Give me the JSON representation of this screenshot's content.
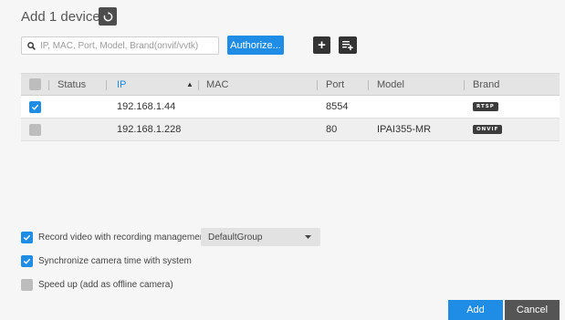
{
  "header": {
    "title": "Add 1 devices",
    "refresh_icon": "refresh-icon"
  },
  "toolbar": {
    "search_placeholder": "IP, MAC, Port, Model, Brand(onvif/vvtk)",
    "search_value": "",
    "authorize_label": "Authorize...",
    "plus_label": "+"
  },
  "table": {
    "columns": {
      "status": "Status",
      "ip": "IP",
      "mac": "MAC",
      "port": "Port",
      "model": "Model",
      "brand": "Brand"
    },
    "sort_indicator": "▲",
    "rows": [
      {
        "checked": true,
        "status": "",
        "ip": "192.168.1.44",
        "mac": "",
        "port": "8554",
        "model": "",
        "brand": "RTSP"
      },
      {
        "checked": false,
        "status": "",
        "ip": "192.168.1.228",
        "mac": "",
        "port": "80",
        "model": "IPAI355-MR",
        "brand": "ONVIF"
      }
    ]
  },
  "options": {
    "record_label": "Record video with recording management:",
    "record_checked": true,
    "group_value": "DefaultGroup",
    "sync_label": "Synchronize camera time with system",
    "sync_checked": true,
    "speedup_label": "Speed up (add as offline camera)",
    "speedup_checked": false
  },
  "footer": {
    "add_label": "Add",
    "cancel_label": "Cancel"
  },
  "colors": {
    "accent": "#1f8ce6",
    "dark_button": "#333333",
    "badge": "#3c3c3c"
  }
}
